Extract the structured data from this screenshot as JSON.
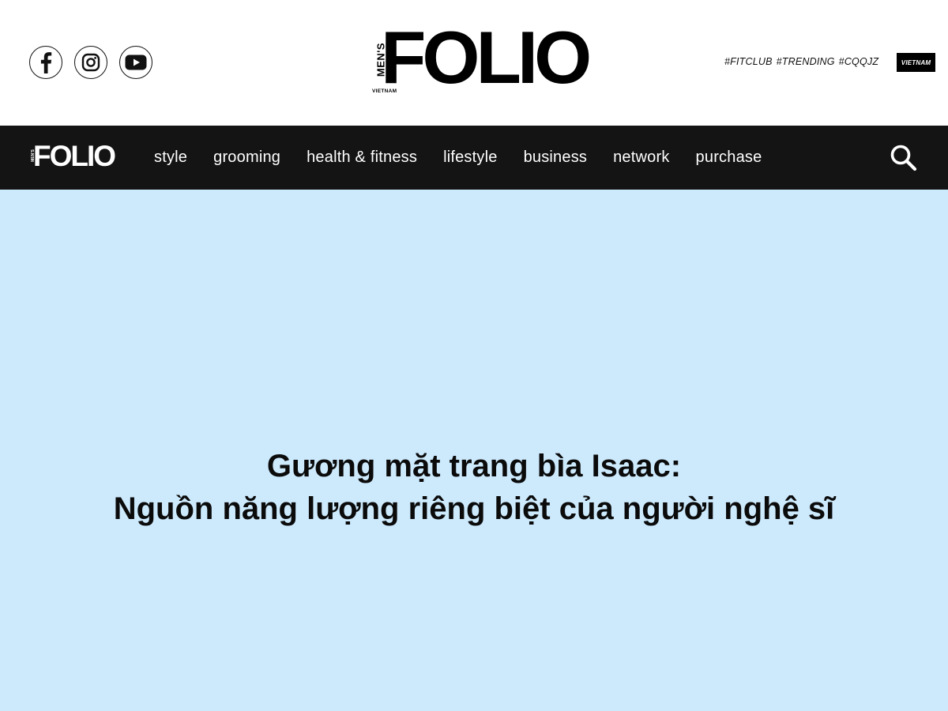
{
  "header": {
    "social": [
      {
        "name": "facebook",
        "icon": "facebook-icon"
      },
      {
        "name": "instagram",
        "icon": "instagram-icon"
      },
      {
        "name": "youtube",
        "icon": "youtube-icon"
      }
    ],
    "logo": {
      "mens": "MEN'S",
      "word": "FOLIO",
      "region": "VIETNAM"
    },
    "tags": [
      "#FITCLUB",
      "#TRENDING",
      "#CQQJZ"
    ],
    "region_badge": "VIETNAM"
  },
  "nav": {
    "logo": {
      "mens": "MEN'S",
      "word": "FOLIO"
    },
    "links": [
      "style",
      "grooming",
      "health & fitness",
      "lifestyle",
      "business",
      "network",
      "purchase"
    ],
    "search_icon": "search-icon"
  },
  "hero": {
    "title_line1": "Gương mặt trang bìa Isaac:",
    "title_line2": "Nguồn năng lượng riêng biệt của người nghệ sĩ"
  },
  "colors": {
    "nav_background": "#141414",
    "hero_background": "#cdeafd",
    "text_dark": "#0b0b0b"
  }
}
